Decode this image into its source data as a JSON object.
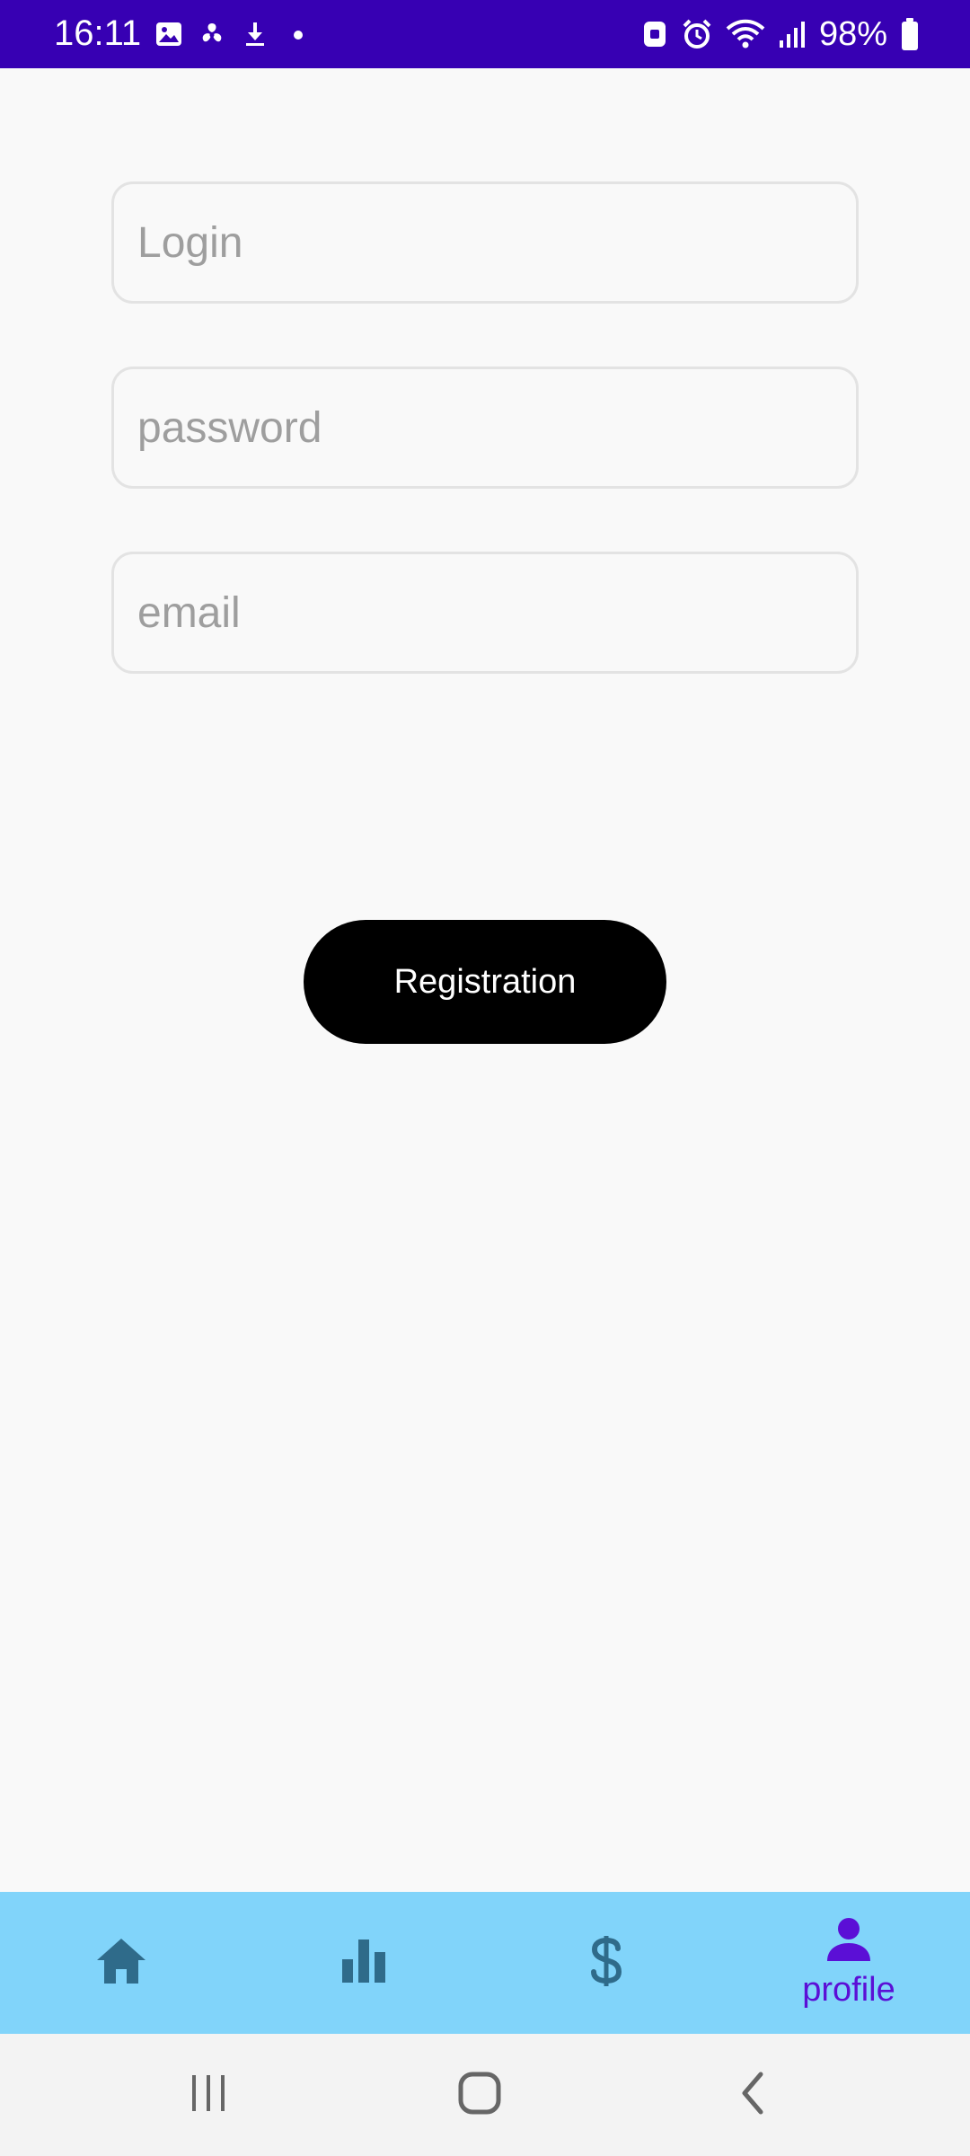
{
  "status_bar": {
    "time": "16:11",
    "battery": "98%",
    "left_icons": [
      "gallery-icon",
      "fan-icon",
      "download-icon",
      "dot-icon"
    ],
    "right_icons": [
      "nfc-icon",
      "alarm-icon",
      "wifi-icon",
      "signal-icon",
      "battery-icon"
    ]
  },
  "form": {
    "login_placeholder": "Login",
    "login_value": "",
    "password_placeholder": "password",
    "password_value": "",
    "email_placeholder": "email",
    "email_value": ""
  },
  "registration_button": {
    "label": "Registration"
  },
  "bottom_nav": {
    "items": [
      {
        "icon": "home-icon",
        "label": ""
      },
      {
        "icon": "bar-chart-icon",
        "label": ""
      },
      {
        "icon": "dollar-icon",
        "label": ""
      },
      {
        "icon": "person-icon",
        "label": "profile",
        "active": true
      }
    ]
  },
  "colors": {
    "status_bar": "#3700b3",
    "bottom_nav": "#81d4fa",
    "nav_icon": "#2f6b8a",
    "active": "#5b0fd6",
    "button": "#000000",
    "background": "#f9f9f9"
  }
}
